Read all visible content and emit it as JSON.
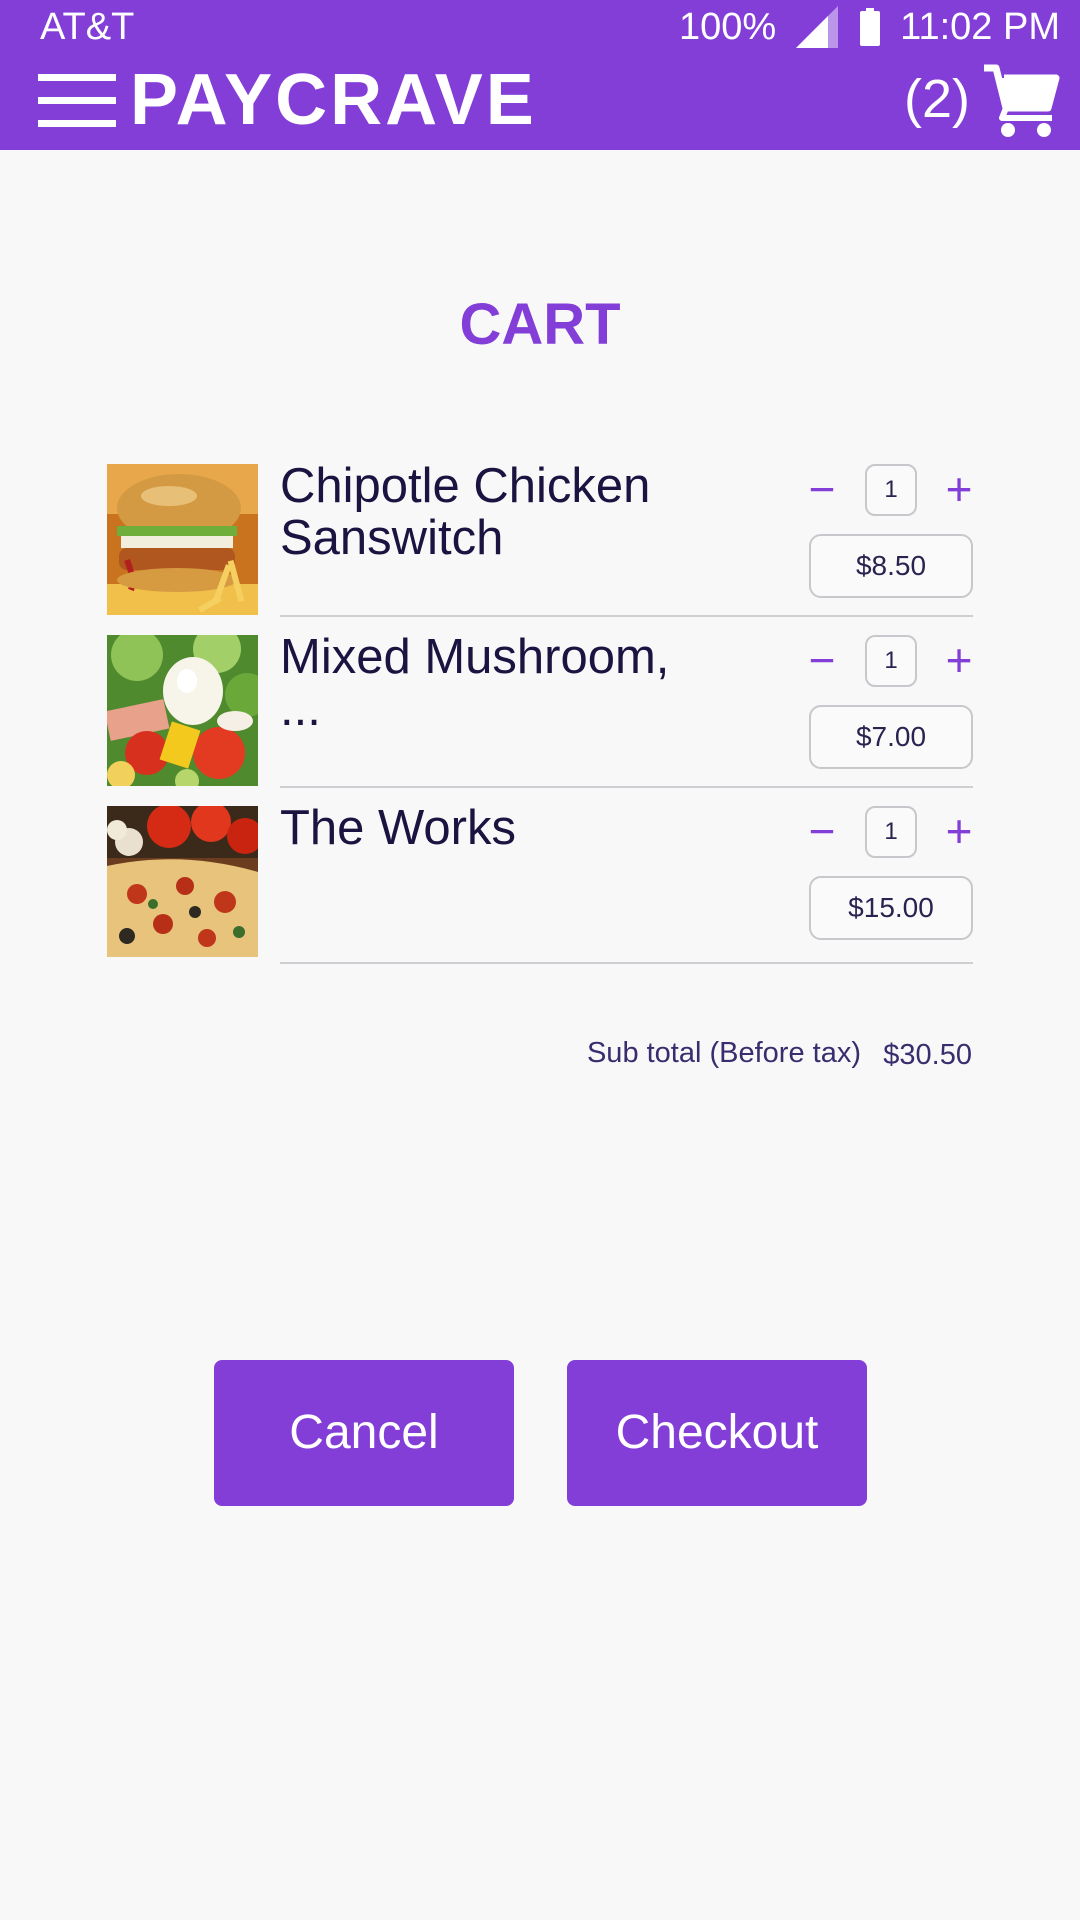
{
  "status_bar": {
    "carrier": "AT&T",
    "battery_percent": "100%",
    "time": "11:02 PM"
  },
  "app_bar": {
    "brand": "PAYCRAVE",
    "cart_count": "(2)"
  },
  "page": {
    "title": "CART"
  },
  "cart": {
    "items": [
      {
        "name": "Chipotle Chicken Sanswitch",
        "quantity": "1",
        "price": "$8.50",
        "image": "burger-photo"
      },
      {
        "name": "Mixed Mushroom, ...",
        "quantity": "1",
        "price": "$7.00",
        "image": "salad-photo"
      },
      {
        "name": "The Works",
        "quantity": "1",
        "price": "$15.00",
        "image": "pizza-photo"
      }
    ],
    "minus_symbol": "−",
    "plus_symbol": "+",
    "subtotal_label": "Sub total (Before tax)",
    "subtotal_value": "$30.50"
  },
  "actions": {
    "cancel_label": "Cancel",
    "checkout_label": "Checkout"
  },
  "colors": {
    "accent": "#843ed8",
    "background": "#f8f8f9",
    "text_dark": "#1b1340"
  }
}
